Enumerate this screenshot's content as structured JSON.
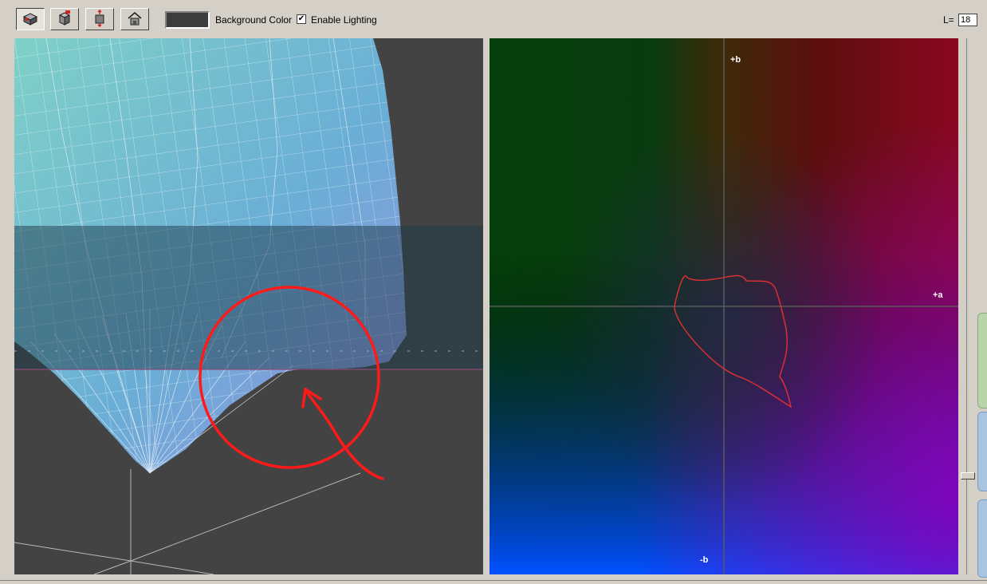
{
  "toolbar": {
    "buttons": [
      {
        "name": "3d-view-icon",
        "active": true
      },
      {
        "name": "cube-color-icon",
        "active": false
      },
      {
        "name": "rotate-object-icon",
        "active": false
      },
      {
        "name": "home-view-icon",
        "active": false
      }
    ],
    "background_color_label": "Background Color",
    "background_color_value": "#3c3c3c",
    "enable_lighting_label": "Enable Lighting",
    "enable_lighting_checked": true,
    "l_label": "L=",
    "l_value": "18"
  },
  "plot": {
    "label_plus_b": "+b",
    "label_minus_b": "-b",
    "label_plus_a": "+a"
  },
  "colors": {
    "panel_bg": "#434343",
    "annotation": "#ff1a1a",
    "gamut_outline": "#d83030",
    "mesh": "#7ab8d4"
  }
}
